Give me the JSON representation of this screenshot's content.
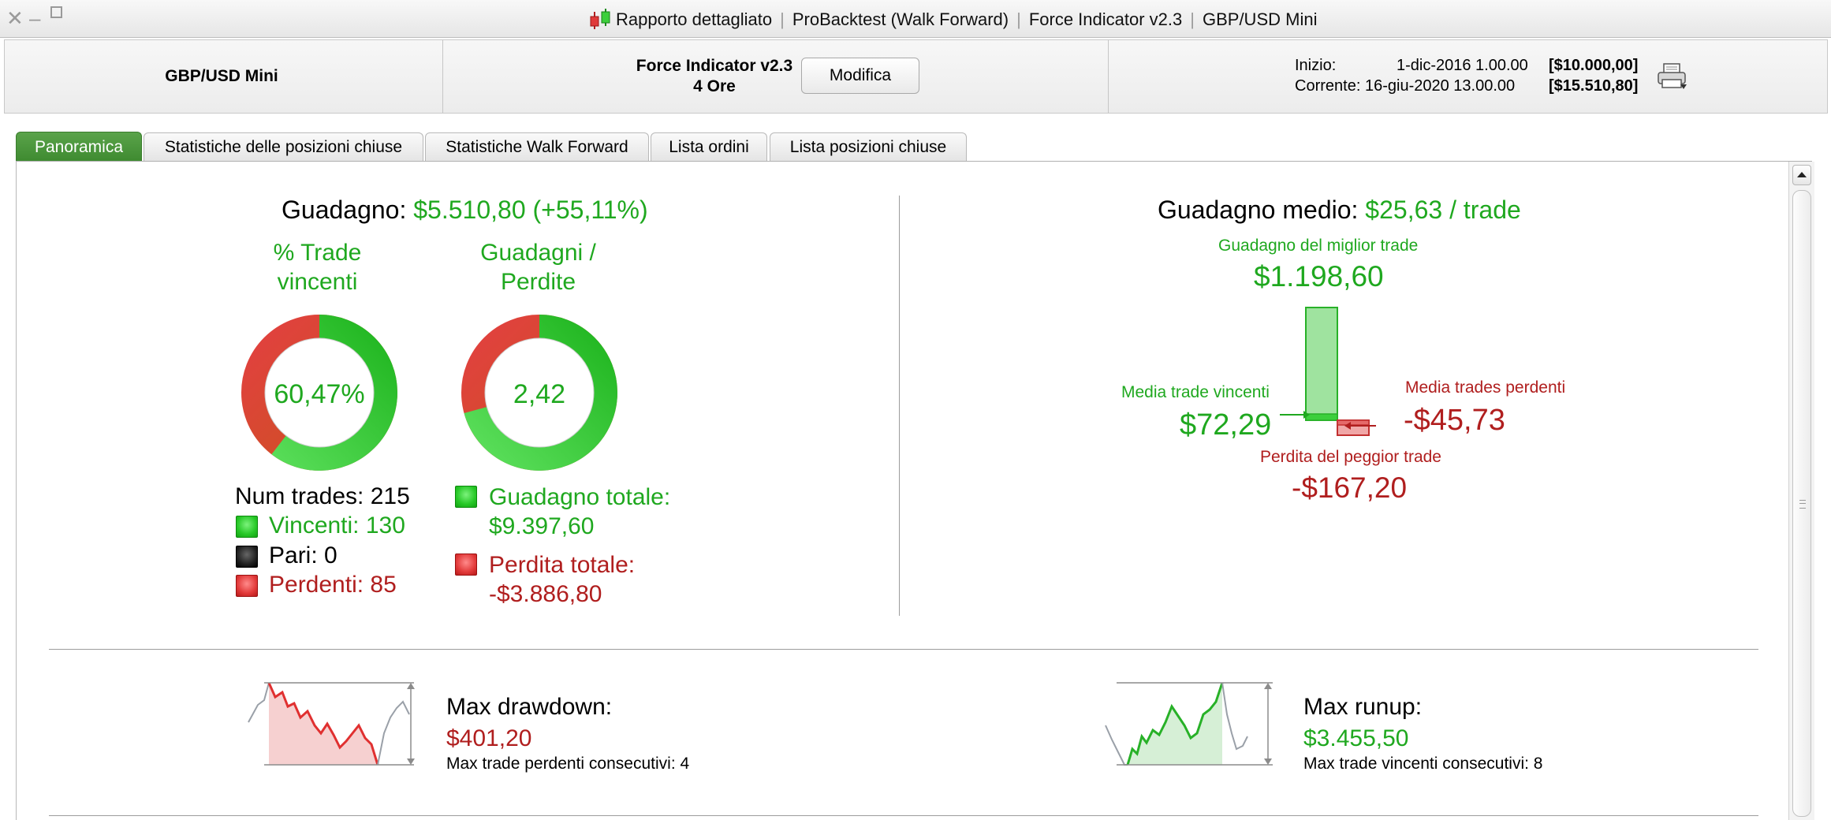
{
  "window": {
    "title_parts": [
      "Rapporto dettagliato",
      "ProBacktest (Walk Forward)",
      "Force Indicator v2.3",
      "GBP/USD Mini"
    ]
  },
  "header": {
    "instrument": "GBP/USD Mini",
    "strategy_name": "Force Indicator v2.3",
    "timeframe": "4 Ore",
    "modify_label": "Modifica",
    "start_label": "Inizio:",
    "start_date": "1-dic-2016 1.00.00",
    "start_capital": "[$10.000,00]",
    "current_label": "Corrente:",
    "current_date": "16-giu-2020 13.00.00",
    "current_capital": "[$15.510,80]"
  },
  "tabs": [
    {
      "label": "Panoramica",
      "active": true
    },
    {
      "label": "Statistiche delle posizioni chiuse",
      "active": false
    },
    {
      "label": "Statistiche Walk Forward",
      "active": false
    },
    {
      "label": "Lista ordini",
      "active": false
    },
    {
      "label": "Lista posizioni chiuse",
      "active": false
    }
  ],
  "overview": {
    "gain_label": "Guadagno:",
    "gain_value": "$5.510,80 (+55,11%)",
    "win_rate": {
      "title_line1": "% Trade",
      "title_line2": "vincenti",
      "center_text": "60,47%",
      "win_fraction": 0.6047
    },
    "profit_loss": {
      "title_line1": "Guadagni /",
      "title_line2": "Perdite",
      "center_text": "2,42",
      "gain_fraction": 0.7074
    },
    "num_trades_label": "Num trades: 215",
    "winners_label": "Vincenti: 130",
    "even_label": "Pari: 0",
    "losers_label": "Perdenti: 85",
    "total_gain_label": "Guadagno totale:",
    "total_gain_value": "$9.397,60",
    "total_loss_label": "Perdita totale:",
    "total_loss_value": "-$3.886,80"
  },
  "average": {
    "label": "Guadagno medio:",
    "value": "$25,63 / trade",
    "best_label": "Guadagno del miglior trade",
    "best_value": "$1.198,60",
    "avg_win_label": "Media trade vincenti",
    "avg_win_value": "$72,29",
    "avg_loss_label": "Media trades perdenti",
    "avg_loss_value": "-$45,73",
    "worst_label": "Perdita del peggior trade",
    "worst_value": "-$167,20"
  },
  "drawdown": {
    "title": "Max drawdown:",
    "value": "$401,20",
    "sub": "Max trade perdenti consecutivi:  4"
  },
  "runup": {
    "title": "Max runup:",
    "value": "$3.455,50",
    "sub": "Max trade vincenti consecutivi: 8"
  },
  "colors": {
    "green": "#1fa81f",
    "red": "#b01e1e",
    "active_tab": "#4a9a3c"
  }
}
